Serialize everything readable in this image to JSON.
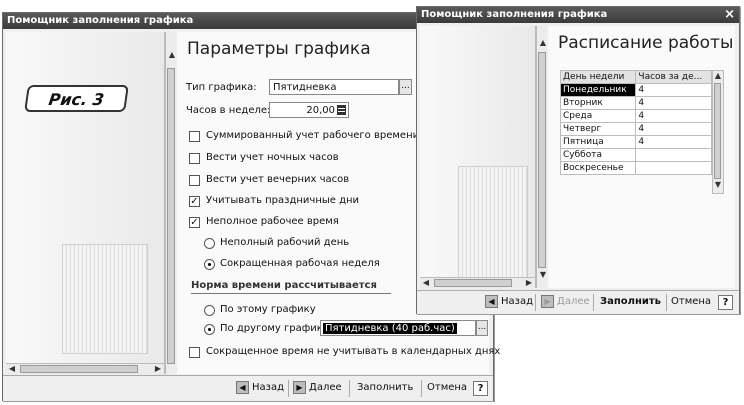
{
  "left_window": {
    "title": "Помощник заполнения графика",
    "badge": "Рис. 3",
    "heading": "Параметры графика",
    "schedule_type_label": "Тип графика:",
    "schedule_type_value": "Пятидневка",
    "hours_label": "Часов в неделе:",
    "hours_value": "20,00",
    "checkboxes": [
      {
        "label": "Суммированный учет рабочего времени",
        "checked": false
      },
      {
        "label": "Вести учет ночных часов",
        "checked": false
      },
      {
        "label": "Вести учет вечерних часов",
        "checked": false
      },
      {
        "label": "Учитывать праздничные дни",
        "checked": true
      },
      {
        "label": "Неполное рабочее время",
        "checked": true
      }
    ],
    "radio_parttime": [
      {
        "label": "Неполный рабочий день",
        "selected": false
      },
      {
        "label": "Сокращенная рабочая неделя",
        "selected": true
      }
    ],
    "norm_section_title": "Норма времени рассчитывается",
    "radio_norm": [
      {
        "label": "По этому графику",
        "selected": false
      },
      {
        "label": "По другому графику:",
        "selected": true
      }
    ],
    "other_schedule_value": "Пятидневка (40 раб.час)",
    "last_checkbox": {
      "label": "Сокращенное время не учитывать в календарных днях",
      "checked": false
    },
    "buttons": {
      "back": "Назад",
      "next": "Далее",
      "fill": "Заполнить",
      "cancel": "Отмена",
      "help": "?"
    },
    "dots": "..."
  },
  "right_window": {
    "title": "Помощник заполнения графика",
    "close": "×",
    "heading": "Расписание работы",
    "table": {
      "headers": [
        "День недели",
        "Часов за де..."
      ],
      "rows": [
        {
          "day": "Понедельник",
          "hours": "4"
        },
        {
          "day": "Вторник",
          "hours": "4"
        },
        {
          "day": "Среда",
          "hours": "4"
        },
        {
          "day": "Четверг",
          "hours": "4"
        },
        {
          "day": "Пятница",
          "hours": "4"
        },
        {
          "day": "Суббота",
          "hours": ""
        },
        {
          "day": "Воскресенье",
          "hours": ""
        }
      ]
    },
    "buttons": {
      "back": "Назад",
      "next": "Далее",
      "fill": "Заполнить",
      "cancel": "Отмена",
      "help": "?"
    }
  }
}
